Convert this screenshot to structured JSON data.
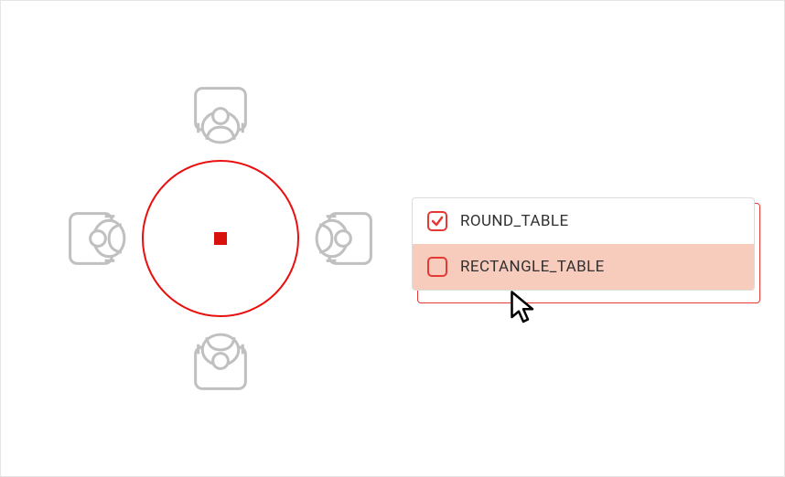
{
  "diagram": {
    "table_shape": "round"
  },
  "options": [
    {
      "label": "ROUND_TABLE",
      "checked": true,
      "hover": false
    },
    {
      "label": "RECTANGLE_TABLE",
      "checked": false,
      "hover": true
    }
  ],
  "colors": {
    "accent": "#e53935",
    "hoverBg": "#f7ccbd",
    "shape": "#bfbfbf"
  }
}
